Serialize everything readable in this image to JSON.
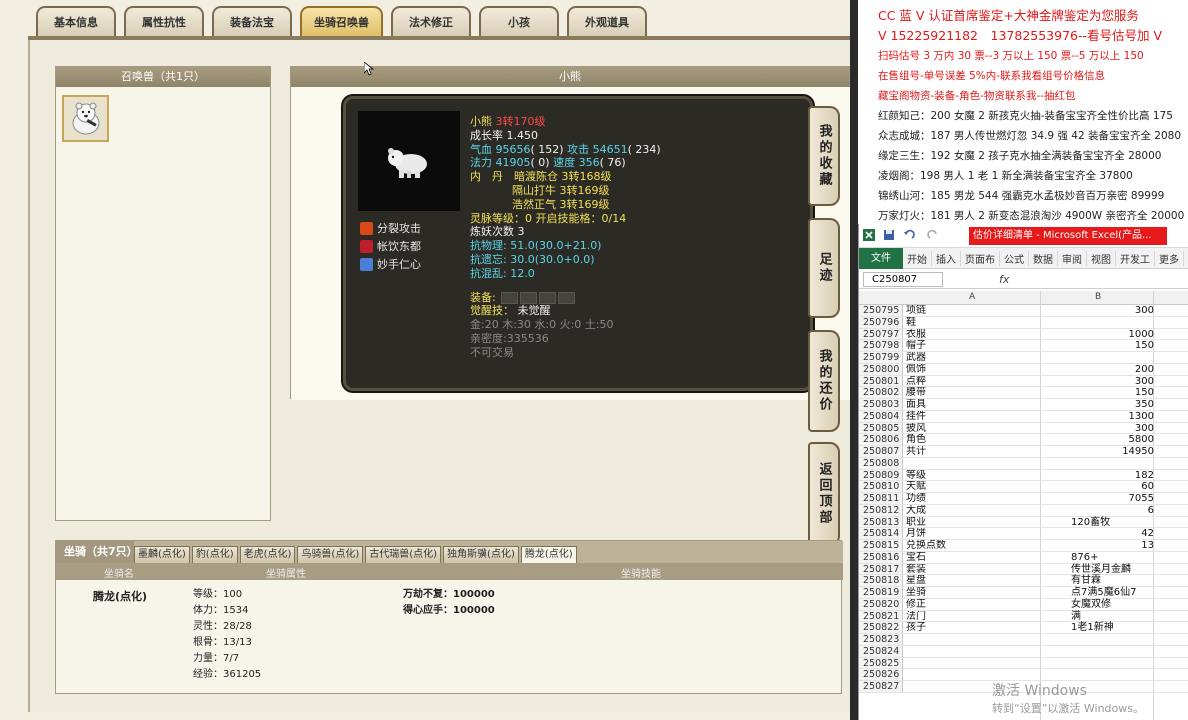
{
  "game": {
    "tabs": [
      "基本信息",
      "属性抗性",
      "装备法宝",
      "坐骑召唤兽",
      "法术修正",
      "小孩",
      "外观道具"
    ],
    "active_tab_index": 3,
    "summon_panel_title": "召唤兽（共1只）",
    "detail_panel_title": "小熊",
    "pet": {
      "name": "小熊",
      "level": "3转170级",
      "growth": "成长率 1.450",
      "hp_label": "气血",
      "hp_value": "95656",
      "hp_extra": "( 152)",
      "atk_label": "攻击",
      "atk_value": "54651",
      "atk_extra": "( 234)",
      "mp_label": "法力",
      "mp_value": "41905",
      "mp_extra": "( 0)",
      "spd_label": "速度",
      "spd_value": "356",
      "spd_extra": "( 76)",
      "inner_dan_label": "内　丹",
      "inner_dan": [
        {
          "name": "暗渡陈仓",
          "level": "3转168级"
        },
        {
          "name": "隔山打牛",
          "level": "3转169级"
        },
        {
          "name": "浩然正气",
          "level": "3转169级"
        }
      ],
      "spirit_level": "灵脉等级：0 开启技能格：0/14",
      "refine_count": "炼妖次数 3",
      "resist_physical": "抗物理: 51.0(30.0+21.0)",
      "resist_forget": "抗遗忘: 30.0(30.0+0.0)",
      "resist_chaos": "抗混乱: 12.0",
      "equip_label": "装备:",
      "awaken": "觉醒技：",
      "awaken_value": "未觉醒",
      "elements": "金:20 木:30 水:0 火:0 土:50",
      "intimacy": "亲密度:335536",
      "untradable": "不可交易",
      "skills": [
        "分裂攻击",
        "帐饮东都",
        "妙手仁心"
      ]
    },
    "side_buttons": [
      "我的收藏",
      "足迹",
      "我的还价",
      "返回顶部"
    ],
    "mount": {
      "title": "坐骑（共7只）",
      "tabs": [
        "墨麟(点化)",
        "豹(点化)",
        "老虎(点化)",
        "鸟骑兽(点化)",
        "古代瑞兽(点化)",
        "独角斯骥(点化)",
        "腾龙(点化)"
      ],
      "active_tab_index": 6,
      "head": [
        "坐骑名",
        "坐骑属性",
        "坐骑技能"
      ],
      "name": "腾龙(点化)",
      "attrs": [
        "等级：100",
        "体力：1534",
        "灵性：28/28",
        "根骨：13/13",
        "力量：7/7",
        "经验：361205"
      ],
      "skills": [
        "万劫不复：100000",
        "得心应手：100000"
      ]
    }
  },
  "ad": {
    "lines": [
      "CC 蓝 V 认证首席鉴定+大神金牌鉴定为您服务",
      "V 15225921182　13782553976--看号估号加 V",
      "扫码估号 3 万内 30 票--3 万以上 150 票--5 万以上 150",
      "在售组号-单号误差 5%内-联系我看组号价格信息",
      "藏宝阁物资-装备-角色-物资联系我--抽红包"
    ],
    "dark_lines": [
      "红颜知己：200 女魔 2 新孩克火抽-装备宝宝齐全性价比高 175",
      "众志成城：187 男人传世燃灯忽 34.9 强 42 装备宝宝齐全 2080",
      "缘定三生：192 女魔 2 孩子克水抽全满装备宝宝齐全 28000",
      "凌烟阁：198 男人 1 老 1 新全满装备宝宝齐全 37800",
      "锦绣山河：185 男龙 544 强霸克水孟极妙音百万亲密 89999",
      "万家灯火：181 男人 2 新变态混浪淘沙 4900W 亲密齐全 20000"
    ]
  },
  "excel": {
    "title": "估价详细清单 - Microsoft Excel(产品...",
    "ribbon_file": "文件",
    "ribbon_tabs": [
      "开始",
      "插入",
      "页面布",
      "公式",
      "数据",
      "审阅",
      "视图",
      "开发工",
      "更多"
    ],
    "name_box": "C250807",
    "fx": "fx",
    "col_a": "A",
    "col_b": "B",
    "rows": [
      {
        "n": "250795",
        "a": "项链",
        "b": "300"
      },
      {
        "n": "250796",
        "a": "鞋",
        "b": ""
      },
      {
        "n": "250797",
        "a": "衣服",
        "b": "1000"
      },
      {
        "n": "250798",
        "a": "帽子",
        "b": "150"
      },
      {
        "n": "250799",
        "a": "武器",
        "b": ""
      },
      {
        "n": "250800",
        "a": "佩饰",
        "b": "200"
      },
      {
        "n": "250801",
        "a": "点粹",
        "b": "300"
      },
      {
        "n": "250802",
        "a": "腰带",
        "b": "150"
      },
      {
        "n": "250803",
        "a": "面具",
        "b": "350"
      },
      {
        "n": "250804",
        "a": "挂件",
        "b": "1300"
      },
      {
        "n": "250805",
        "a": "披风",
        "b": "300"
      },
      {
        "n": "250806",
        "a": "角色",
        "b": "5800"
      },
      {
        "n": "250807",
        "a": "共计",
        "b": "14950"
      },
      {
        "n": "250808",
        "a": "",
        "b": ""
      },
      {
        "n": "250809",
        "a": "等级",
        "b": "182"
      },
      {
        "n": "250810",
        "a": "天赋",
        "b": "60"
      },
      {
        "n": "250811",
        "a": "功绩",
        "b": "7055"
      },
      {
        "n": "250812",
        "a": "大成",
        "b": "6"
      },
      {
        "n": "250813",
        "a": "职业",
        "bl": "120畜牧"
      },
      {
        "n": "250814",
        "a": "月饼",
        "b": "42"
      },
      {
        "n": "250815",
        "a": "兑换点数",
        "b": "13"
      },
      {
        "n": "250816",
        "a": "宝石",
        "bl": "876+"
      },
      {
        "n": "250817",
        "a": "套装",
        "bl": "传世溪月金麟"
      },
      {
        "n": "250818",
        "a": "星盘",
        "bl": "有甘霖"
      },
      {
        "n": "250819",
        "a": "坐骑",
        "bl": "点7满5魔6仙7"
      },
      {
        "n": "250820",
        "a": "修正",
        "bl": "女魔双修"
      },
      {
        "n": "250821",
        "a": "法门",
        "bl": "满"
      },
      {
        "n": "250822",
        "a": "孩子",
        "bl": "1老1新神"
      },
      {
        "n": "250823",
        "a": "",
        "b": ""
      },
      {
        "n": "250824",
        "a": "",
        "b": ""
      },
      {
        "n": "250825",
        "a": "",
        "b": ""
      },
      {
        "n": "250826",
        "a": "",
        "b": ""
      },
      {
        "n": "250827",
        "a": "",
        "b": ""
      }
    ]
  },
  "watermark": {
    "line1": "激活 Windows",
    "line2": "转到“设置”以激活 Windows。"
  }
}
